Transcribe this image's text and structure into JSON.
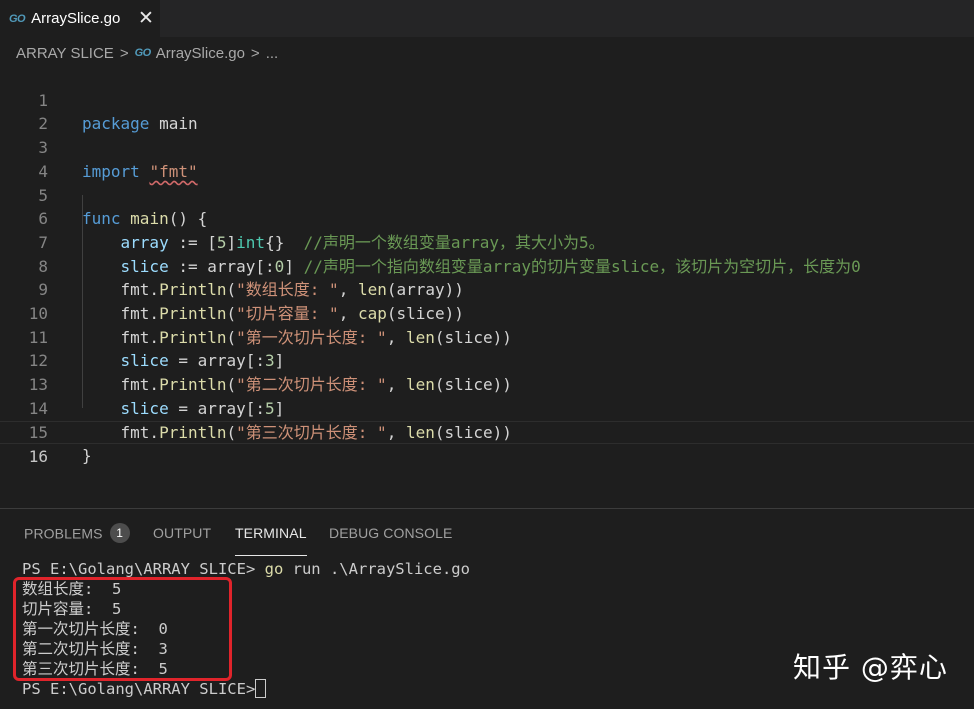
{
  "tab": {
    "icon": "go-file-icon",
    "icon_text": "GO",
    "filename": "ArraySlice.go",
    "close": "✕"
  },
  "breadcrumb": {
    "folder": "ARRAY SLICE",
    "sep": ">",
    "icon_text": "GO",
    "file": "ArraySlice.go",
    "more": "..."
  },
  "editor": {
    "line_numbers": [
      "1",
      "2",
      "3",
      "4",
      "5",
      "6",
      "7",
      "8",
      "9",
      "10",
      "11",
      "12",
      "13",
      "14",
      "15",
      "16"
    ],
    "current_line": "16"
  },
  "panel": {
    "tabs": {
      "problems": "PROBLEMS",
      "problems_count": "1",
      "output": "OUTPUT",
      "terminal": "TERMINAL",
      "debug": "DEBUG CONSOLE"
    },
    "terminal": {
      "prompt": "PS E:\\Golang\\ARRAY SLICE>",
      "command": "go",
      "command_args": " run .\\ArraySlice.go",
      "output": [
        "数组长度:  5",
        "切片容量:  5",
        "第一次切片长度:  0",
        "第二次切片长度:  3",
        "第三次切片长度:  5"
      ]
    }
  },
  "watermark": "知乎 @弈心",
  "colors": {
    "highlight_box": "#e0242b",
    "keyword": "#569cd6",
    "string": "#ce9178",
    "comment": "#6a9955"
  }
}
